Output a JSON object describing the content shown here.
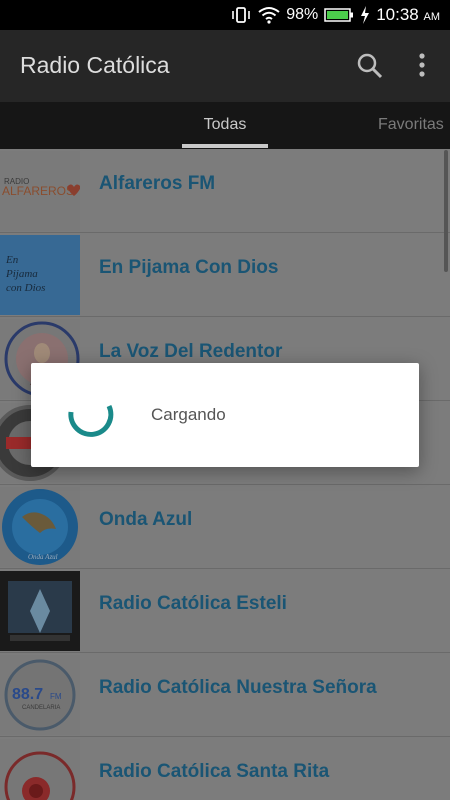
{
  "status_bar": {
    "battery_percent": "98%",
    "time": "10:38",
    "ampm": "AM",
    "icons": [
      "vibrate-icon",
      "wifi-icon",
      "battery-icon",
      "charging-icon"
    ]
  },
  "app_bar": {
    "title": "Radio Católica",
    "icons": [
      "search-icon",
      "more-vert-icon"
    ]
  },
  "tabs": [
    {
      "label": "Todas",
      "selected": true
    },
    {
      "label": "Favoritas",
      "selected": false
    }
  ],
  "stations": [
    {
      "name": "Alfareros FM",
      "logo_text": "RADIO ALFAREROS"
    },
    {
      "name": "En Pijama Con Dios",
      "logo_text": "En Pijama con Dios"
    },
    {
      "name": "La Voz Del Redentor",
      "logo_text": ""
    },
    {
      "name": "",
      "logo_text": ""
    },
    {
      "name": "Onda Azul",
      "logo_text": "Onda Azul"
    },
    {
      "name": "Radio Católica Esteli",
      "logo_text": ""
    },
    {
      "name": "Radio Católica Nuestra Señora",
      "logo_text": "88.7 FM CANDELARIA"
    },
    {
      "name": "Radio Católica Santa Rita",
      "logo_text": ""
    }
  ],
  "dialog": {
    "message": "Cargando"
  },
  "colors": {
    "accent": "#1a8a8a",
    "link_text": "#1a5574",
    "app_bar": "#262626"
  }
}
